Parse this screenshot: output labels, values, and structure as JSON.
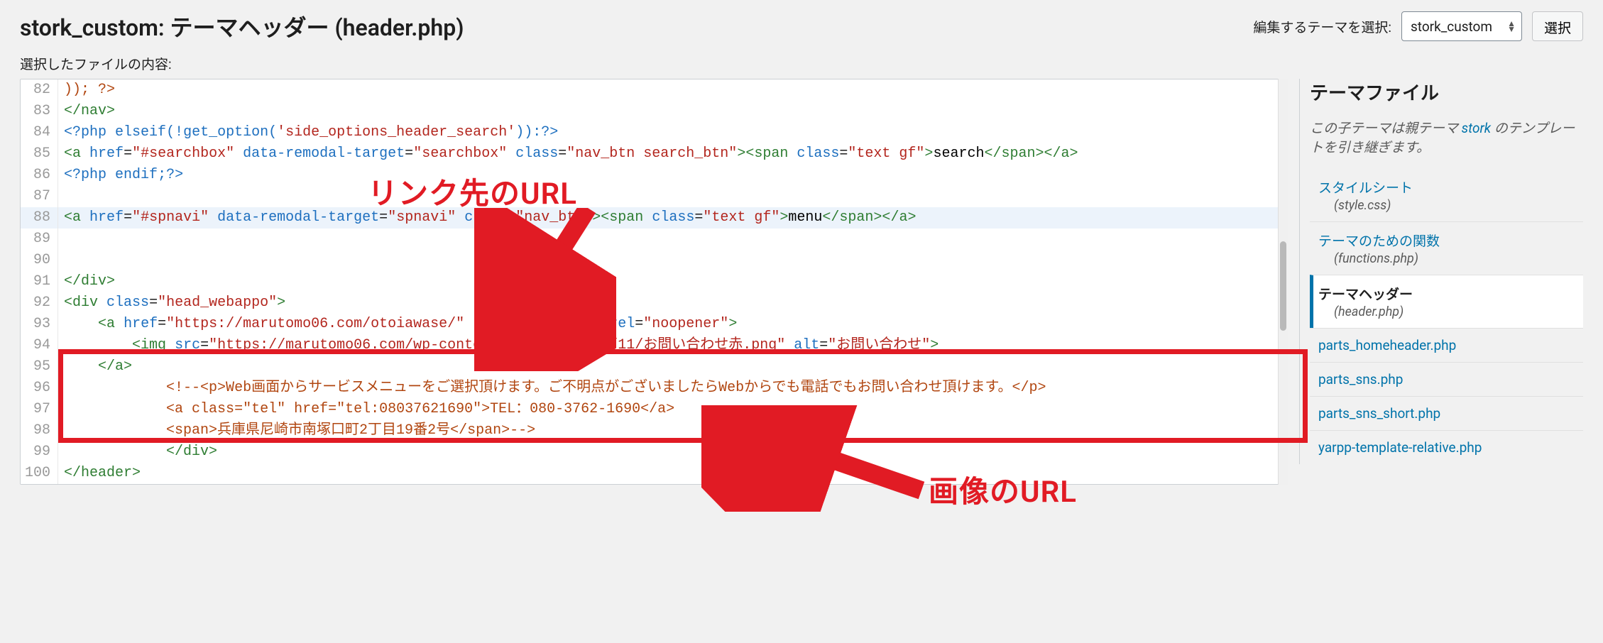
{
  "header": {
    "title": "stork_custom: テーマヘッダー (header.php)",
    "themeSelectLabel": "編集するテーマを選択:",
    "themeSelectValue": "stork_custom",
    "selectButton": "選択"
  },
  "subLabel": "選択したファイルの内容:",
  "code": {
    "lines": [
      {
        "n": 82,
        "html": "<span class='org'>));&nbsp;?&gt;</span>"
      },
      {
        "n": 83,
        "html": "<span class='grn'>&lt;/nav&gt;</span>"
      },
      {
        "n": 84,
        "html": "<span class='blu'>&lt;?php</span> <span class='blu'>elseif</span><span class='blu'>(</span><span class='blu'>!</span><span class='blu'>get_option</span><span class='blu'>(</span><span class='red'>'side_options_header_search'</span><span class='blu'>)):</span><span class='blu'>?&gt;</span>"
      },
      {
        "n": 85,
        "html": "<span class='grn'>&lt;a</span> <span class='blu'>href</span>=<span class='red'>\"#searchbox\"</span> <span class='blu'>data-remodal-target</span>=<span class='red'>\"searchbox\"</span> <span class='blu'>class</span>=<span class='red'>\"nav_btn search_btn\"</span><span class='grn'>&gt;</span><span class='grn'>&lt;span</span> <span class='blu'>class</span>=<span class='red'>\"text gf\"</span><span class='grn'>&gt;</span><span class='blk'>search</span><span class='grn'>&lt;/span&gt;&lt;/a&gt;</span>"
      },
      {
        "n": 86,
        "html": "<span class='blu'>&lt;?php</span> <span class='blu'>endif</span><span class='blu'>;?&gt;</span>"
      },
      {
        "n": 87,
        "html": ""
      },
      {
        "n": 88,
        "hl": true,
        "html": "<span class='grn'>&lt;a</span> <span class='blu'>href</span>=<span class='red'>\"#spnavi\"</span> <span class='blu'>data-remodal-target</span>=<span class='red'>\"spnavi\"</span> <span class='blu'>class</span>=<span class='red'>\"nav_btn\"</span><span class='grn'>&gt;</span><span class='grn'>&lt;span</span> <span class='blu'>class</span>=<span class='red'>\"text gf\"</span><span class='grn'>&gt;</span><span class='blk'>menu</span><span class='grn'>&lt;/span&gt;&lt;/a&gt;</span>"
      },
      {
        "n": 89,
        "html": ""
      },
      {
        "n": 90,
        "html": ""
      },
      {
        "n": 91,
        "html": "<span class='grn'>&lt;/div&gt;</span>"
      },
      {
        "n": 92,
        "html": "<span class='grn'>&lt;div</span> <span class='blu'>class</span>=<span class='red'>\"head_webappo\"</span><span class='grn'>&gt;</span>"
      },
      {
        "n": 93,
        "html": "&nbsp;&nbsp;&nbsp;&nbsp;<span class='grn'>&lt;a</span> <span class='blu'>href</span>=<span class='red'>\"https://marutomo06.com/otoiawase/\"</span> <span class='blu'>target</span>=<span class='red'>\"_blank\"</span> <span class='blu'>rel</span>=<span class='red'>\"noopener\"</span><span class='grn'>&gt;</span>"
      },
      {
        "n": 94,
        "html": "&nbsp;&nbsp;&nbsp;&nbsp;&nbsp;&nbsp;&nbsp;&nbsp;<span class='grn'>&lt;img</span> <span class='blu'>src</span>=<span class='red'>\"https://marutomo06.com/wp-content/uploads/2019/11/お問い合わせ赤.png\"</span> <span class='blu'>alt</span>=<span class='red'>\"お問い合わせ\"</span><span class='grn'>&gt;</span>"
      },
      {
        "n": 95,
        "html": "&nbsp;&nbsp;&nbsp;&nbsp;<span class='grn'>&lt;/a&gt;</span>"
      },
      {
        "n": 96,
        "html": "&nbsp;&nbsp;&nbsp;&nbsp;&nbsp;&nbsp;&nbsp;&nbsp;&nbsp;&nbsp;&nbsp;&nbsp;<span class='org'>&lt;!--&lt;p&gt;Web画面からサービスメニューをご選択頂けます。ご不明点がございましたらWebからでも電話でもお問い合わせ頂けます。&lt;/p&gt;</span>"
      },
      {
        "n": 97,
        "html": "&nbsp;&nbsp;&nbsp;&nbsp;&nbsp;&nbsp;&nbsp;&nbsp;&nbsp;&nbsp;&nbsp;&nbsp;<span class='org'>&lt;a class=\"tel\" href=\"tel:08037621690\"&gt;TEL：080-3762-1690&lt;/a&gt;</span>"
      },
      {
        "n": 98,
        "html": "&nbsp;&nbsp;&nbsp;&nbsp;&nbsp;&nbsp;&nbsp;&nbsp;&nbsp;&nbsp;&nbsp;&nbsp;<span class='org'>&lt;span&gt;兵庫県尼崎市南塚口町2丁目19番2号&lt;/span&gt;--&gt;</span>"
      },
      {
        "n": 99,
        "html": "&nbsp;&nbsp;&nbsp;&nbsp;&nbsp;&nbsp;&nbsp;&nbsp;&nbsp;&nbsp;&nbsp;&nbsp;<span class='grn'>&lt;/div&gt;</span>"
      },
      {
        "n": 100,
        "html": "<span class='grn'>&lt;/header&gt;</span>"
      }
    ]
  },
  "annotations": {
    "urlLabel": "リンク先のURL",
    "imageLabel": "画像のURL"
  },
  "sidebar": {
    "title": "テーマファイル",
    "noteBefore": "この子テーマは親テーマ ",
    "noteLink": "stork",
    "noteAfter": " のテンプレートを引き継ぎます。",
    "files": [
      {
        "label": "スタイルシート",
        "sub": "(style.css)",
        "active": false
      },
      {
        "label": "テーマのための関数",
        "sub": "(functions.php)",
        "active": false
      },
      {
        "label": "テーマヘッダー",
        "sub": "(header.php)",
        "active": true
      },
      {
        "label": "parts_homeheader.php",
        "sub": "",
        "active": false
      },
      {
        "label": "parts_sns.php",
        "sub": "",
        "active": false
      },
      {
        "label": "parts_sns_short.php",
        "sub": "",
        "active": false
      },
      {
        "label": "yarpp-template-relative.php",
        "sub": "",
        "active": false
      }
    ]
  }
}
